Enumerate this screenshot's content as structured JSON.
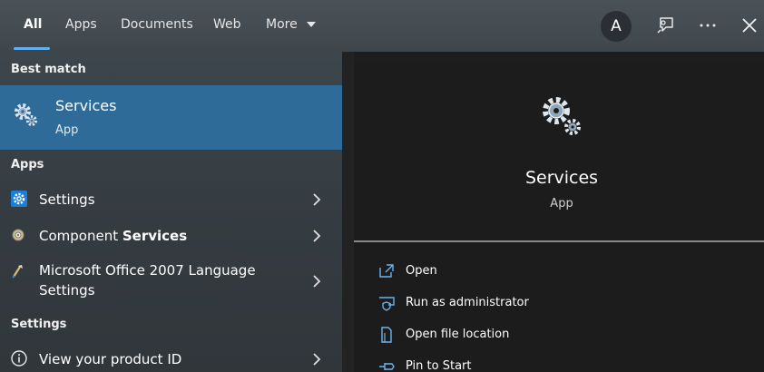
{
  "tabs": [
    "All",
    "Apps",
    "Documents",
    "Web",
    "More"
  ],
  "avatar_letter": "A",
  "sections": {
    "best_match": "Best match",
    "apps": "Apps",
    "settings": "Settings"
  },
  "best_match": {
    "title": "Services",
    "subtitle": "App"
  },
  "apps": [
    {
      "label": "Settings"
    },
    {
      "label_pre": "Component ",
      "label_bold": "Services"
    },
    {
      "label_line1": "Microsoft Office 2007 Language",
      "label_line2": "Settings"
    }
  ],
  "settings_items": [
    {
      "label": "View your product ID"
    }
  ],
  "preview": {
    "title": "Services",
    "subtitle": "App"
  },
  "actions": [
    {
      "label": "Open"
    },
    {
      "label": "Run as administrator"
    },
    {
      "label": "Open file location"
    },
    {
      "label": "Pin to Start"
    }
  ],
  "colors": {
    "accent": "#5fb2f2",
    "selected_row": "#2f6b99",
    "action_icon": "#6cb4f0"
  },
  "icons": [
    "services-gear-icon",
    "settings-gear-icon",
    "component-services-icon",
    "office-language-icon",
    "info-icon",
    "chevron-right-icon",
    "open-icon",
    "run-as-admin-icon",
    "file-location-icon",
    "pin-icon",
    "feedback-icon",
    "more-icon",
    "close-icon",
    "chevron-down-icon"
  ]
}
